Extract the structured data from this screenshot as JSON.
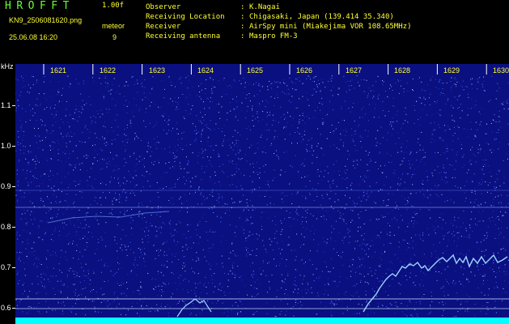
{
  "header": {
    "app_title": "HROFFT",
    "version": "1.00f",
    "filename": "KN9_2506081620.png",
    "mode": "meteor",
    "datetime": "25.06.08 16:20",
    "count": "9",
    "meta": [
      {
        "label": "Observer",
        "value": "K.Nagai"
      },
      {
        "label": "Receiving Location",
        "value": "Chigasaki, Japan (139.414 35.340)"
      },
      {
        "label": "Receiver",
        "value": "AirSpy mini (Miakejima VOR 108.65MHz)"
      },
      {
        "label": "Receiving antenna",
        "value": "Maspro FM-3"
      }
    ],
    "separator": ":"
  },
  "colors": {
    "title": "#66ff33",
    "header_text": "#ffff33",
    "background_plot": "#0a1080",
    "noise": "#4a6cff",
    "trace": "#9fd3ff",
    "bottom_band": "#00ffff"
  },
  "plot": {
    "unit_label": "kHz",
    "y_labels": [
      "1.1",
      "1.0",
      "0.9",
      "0.8",
      "0.7",
      "0.6"
    ],
    "time_labels": [
      "1621",
      "1622",
      "1623",
      "1624",
      "1625",
      "1626",
      "1627",
      "1628",
      "1629",
      "1630"
    ]
  }
}
